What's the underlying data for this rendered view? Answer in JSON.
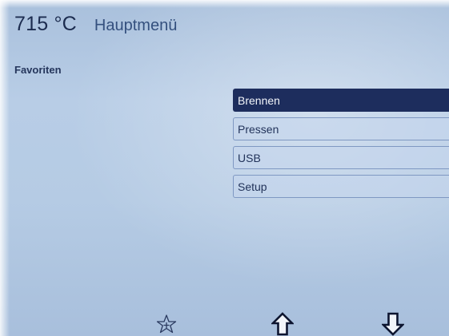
{
  "header": {
    "temperature": "715 °C",
    "title": "Hauptmenü"
  },
  "favorites_label": "Favoriten",
  "menu": {
    "items": [
      {
        "label": "Brennen",
        "selected": true
      },
      {
        "label": "Pressen",
        "selected": false
      },
      {
        "label": "USB",
        "selected": false
      },
      {
        "label": "Setup",
        "selected": false
      }
    ]
  },
  "softkeys": {
    "icons": [
      "star-add-icon",
      "arrow-up-icon",
      "arrow-down-icon"
    ]
  },
  "colors": {
    "screen_background": "#b5cbe4",
    "selected_item": "#1d2d5d",
    "text_primary": "#1c2c4f"
  }
}
